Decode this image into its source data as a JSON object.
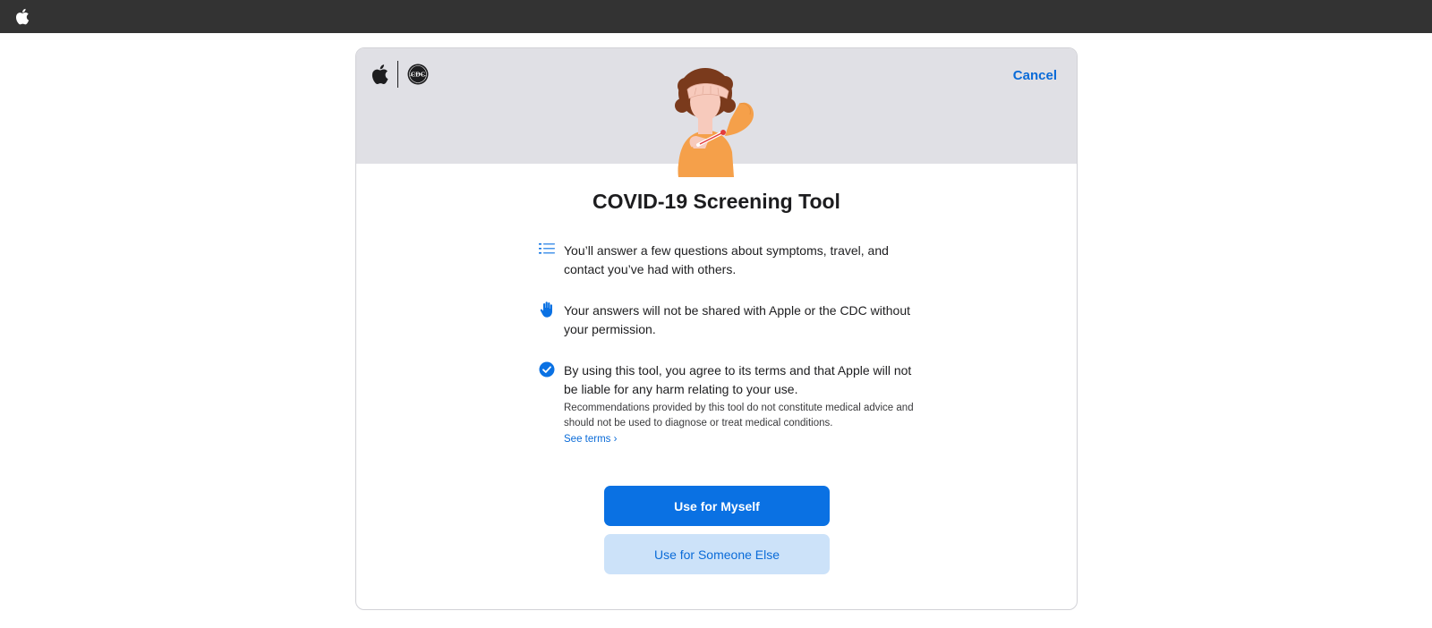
{
  "colors": {
    "topbar": "#333333",
    "header_bg": "#e0e0e5",
    "accent": "#0a71e3",
    "secondary_bg": "#cce2f9",
    "link": "#0a6bd8"
  },
  "topbar": {
    "logo_icon": "apple-logo-icon"
  },
  "header": {
    "logos": [
      "apple-logo-icon",
      "cdc-logo-icon"
    ],
    "cancel_label": "Cancel",
    "hero_icon": "person-with-thermometer-illustration"
  },
  "main": {
    "title": "COVID-19 Screening Tool",
    "items": [
      {
        "icon": "list-icon",
        "text": "You’ll answer a few questions about symptoms, travel, and contact you’ve had with others."
      },
      {
        "icon": "hand-icon",
        "text": "Your answers will not be shared with Apple or the CDC without your permission."
      },
      {
        "icon": "checkmark-circle-icon",
        "text": "By using this tool, you agree to its terms and that Apple will not be liable for any harm relating to your use.",
        "subtext": "Recommendations provided by this tool do not constitute medical advice and should not be used to diagnose or treat medical conditions.",
        "link": "See terms ›"
      }
    ],
    "primary_button": "Use for Myself",
    "secondary_button": "Use for Someone Else"
  }
}
